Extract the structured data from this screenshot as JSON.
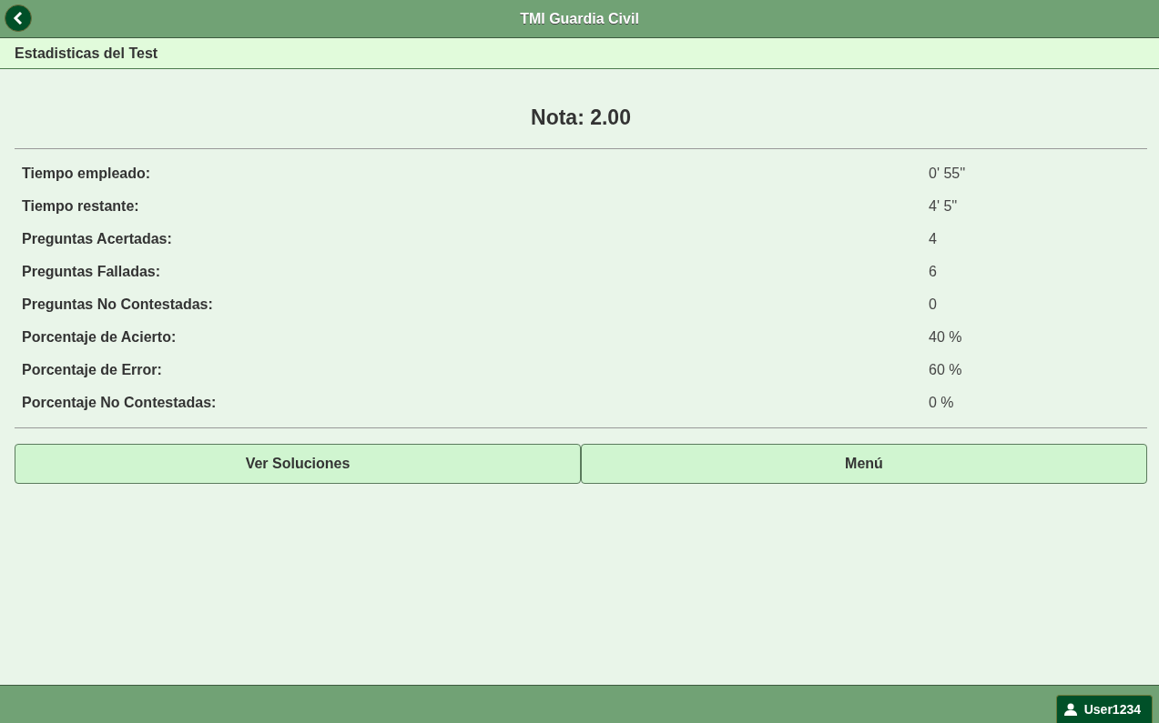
{
  "header": {
    "title": "TMI Guardia Civil"
  },
  "subheader": {
    "title": "Estadisticas del Test"
  },
  "grade": "Nota: 2.00",
  "stats": [
    {
      "label": "Tiempo empleado:",
      "value": "0' 55''"
    },
    {
      "label": "Tiempo restante:",
      "value": "4' 5''"
    },
    {
      "label": "Preguntas Acertadas:",
      "value": "4"
    },
    {
      "label": "Preguntas Falladas:",
      "value": "6"
    },
    {
      "label": "Preguntas No Contestadas:",
      "value": "0"
    },
    {
      "label": "Porcentaje de Acierto:",
      "value": "40 %"
    },
    {
      "label": "Porcentaje de Error:",
      "value": "60 %"
    },
    {
      "label": "Porcentaje No Contestadas:",
      "value": "0 %"
    }
  ],
  "buttons": [
    "Ver Soluciones",
    "Menú"
  ],
  "footer": {
    "user": "User1234"
  }
}
